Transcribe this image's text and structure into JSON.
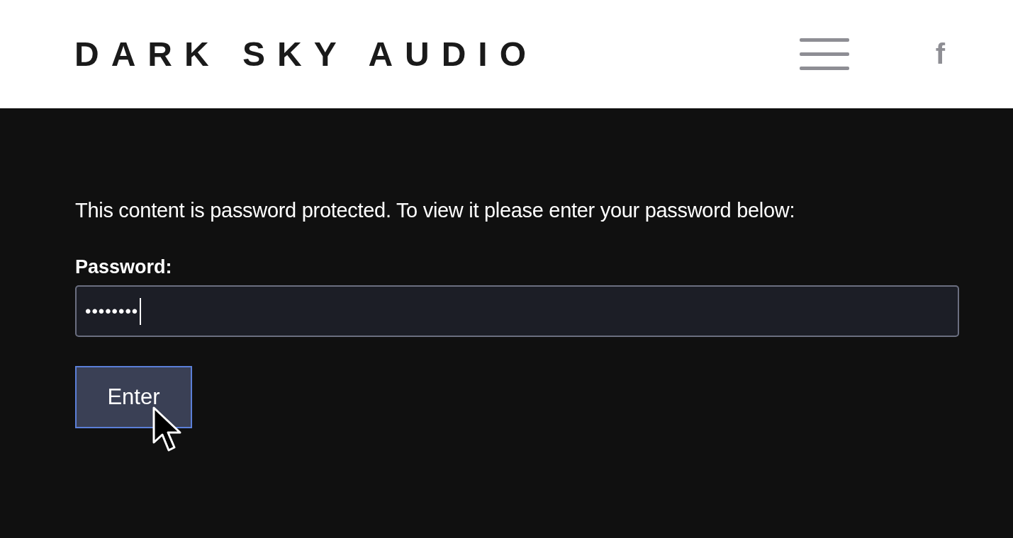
{
  "header": {
    "logo": "DARK SKY AUDIO",
    "social": "f"
  },
  "message": "This content is password protected. To view it please enter your password below:",
  "password_field": {
    "label": "Password:",
    "value": "••••••••",
    "focused": true
  },
  "submit_button": {
    "label": "Enter",
    "hovered": true
  }
}
